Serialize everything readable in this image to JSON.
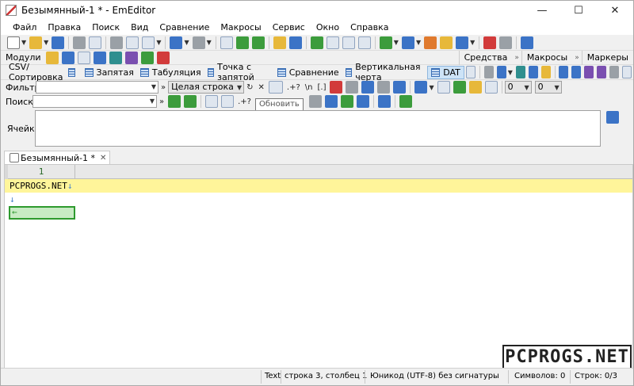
{
  "window": {
    "title": "Безымянный-1 * - EmEditor",
    "minimize": "—",
    "maximize": "☐",
    "close": "✕"
  },
  "menu": [
    "Файл",
    "Правка",
    "Поиск",
    "Вид",
    "Сравнение",
    "Макросы",
    "Сервис",
    "Окно",
    "Справка"
  ],
  "plugins": {
    "label": "Модули"
  },
  "side_tabs": [
    "Средства",
    "Макросы",
    "Маркеры"
  ],
  "csv_modes": [
    "CSV/Сортировка",
    "Запятая",
    "Табуляция",
    "Точка с запятой",
    "Сравнение",
    "Вертикальная черта",
    "DAT"
  ],
  "filter": {
    "label": "Фильтр",
    "value": "",
    "mode": "Целая строка",
    "num1": "0",
    "num2": "0"
  },
  "search": {
    "label": "Поиск",
    "value": "",
    "tooltip": "Обновить"
  },
  "cell": {
    "label": "Ячейка",
    "value": ""
  },
  "doc_tab": {
    "title": "Безымянный-1 *",
    "close": "✕"
  },
  "editor": {
    "column_header": "1",
    "lines": [
      {
        "text": "PCPROGS.NET",
        "eol": "↓"
      },
      {
        "text": "",
        "eol": "↓"
      },
      {
        "text": "",
        "eol": "←"
      }
    ]
  },
  "watermark": "PCPROGS.NET",
  "status": {
    "mode": "Text",
    "position": "строка 3, столбец 1",
    "encoding": "Юникод (UTF-8) без сигнатуры",
    "chars": "Символов: 0",
    "lines": "Строк: 0/3"
  },
  "filter_symbols": [
    ".+?",
    "\\n",
    "[.]"
  ],
  "search_symbols": [
    ".+?"
  ]
}
